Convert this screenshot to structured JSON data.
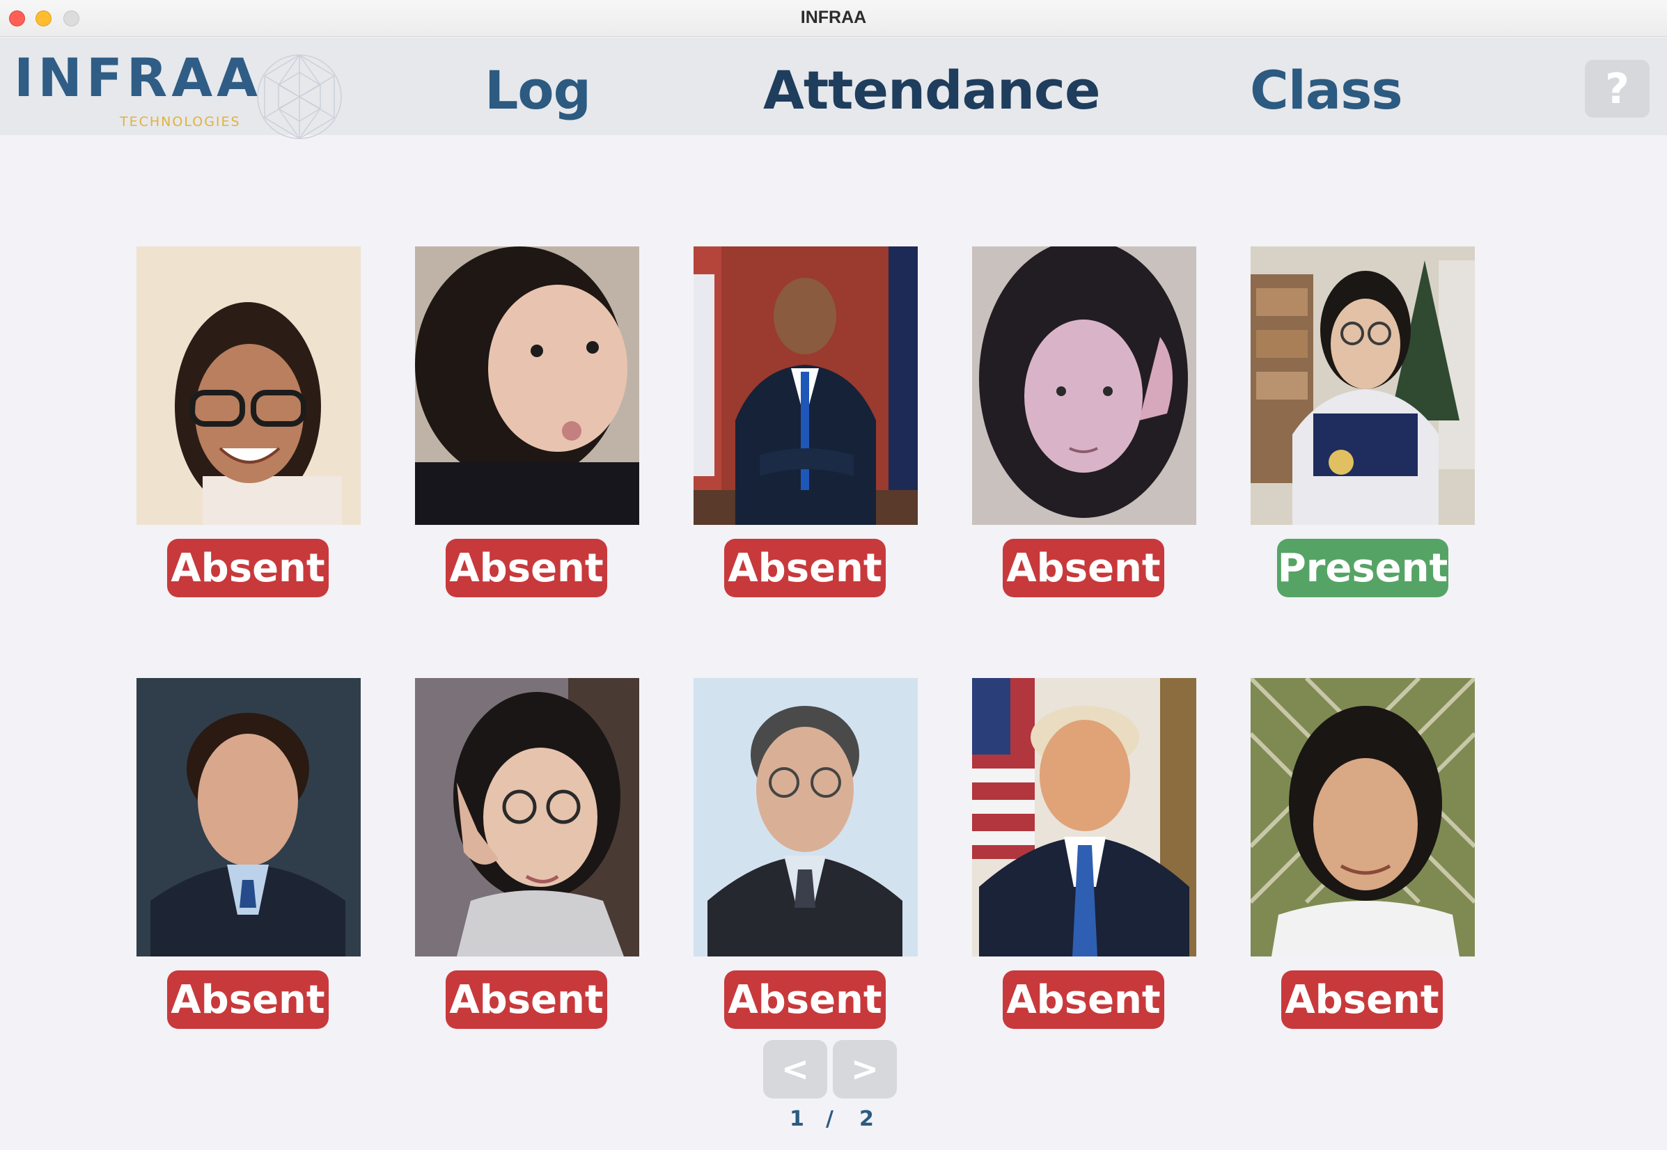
{
  "window": {
    "title": "INFRAA"
  },
  "logo": {
    "main": "INFRAA",
    "sub": "TECHNOLOGIES"
  },
  "nav": {
    "log": "Log",
    "attendance": "Attendance",
    "class": "Class",
    "help": "?"
  },
  "students": [
    {
      "status": "Absent"
    },
    {
      "status": "Absent"
    },
    {
      "status": "Absent"
    },
    {
      "status": "Absent"
    },
    {
      "status": "Present"
    },
    {
      "status": "Absent"
    },
    {
      "status": "Absent"
    },
    {
      "status": "Absent"
    },
    {
      "status": "Absent"
    },
    {
      "status": "Absent"
    }
  ],
  "pagination": {
    "prev": "<",
    "next": ">",
    "current": "1",
    "separator": "/",
    "total": "2"
  },
  "colors": {
    "absent": "#c8393c",
    "present": "#55a466",
    "brand": "#2f5d86",
    "accent": "#e3b23c"
  }
}
